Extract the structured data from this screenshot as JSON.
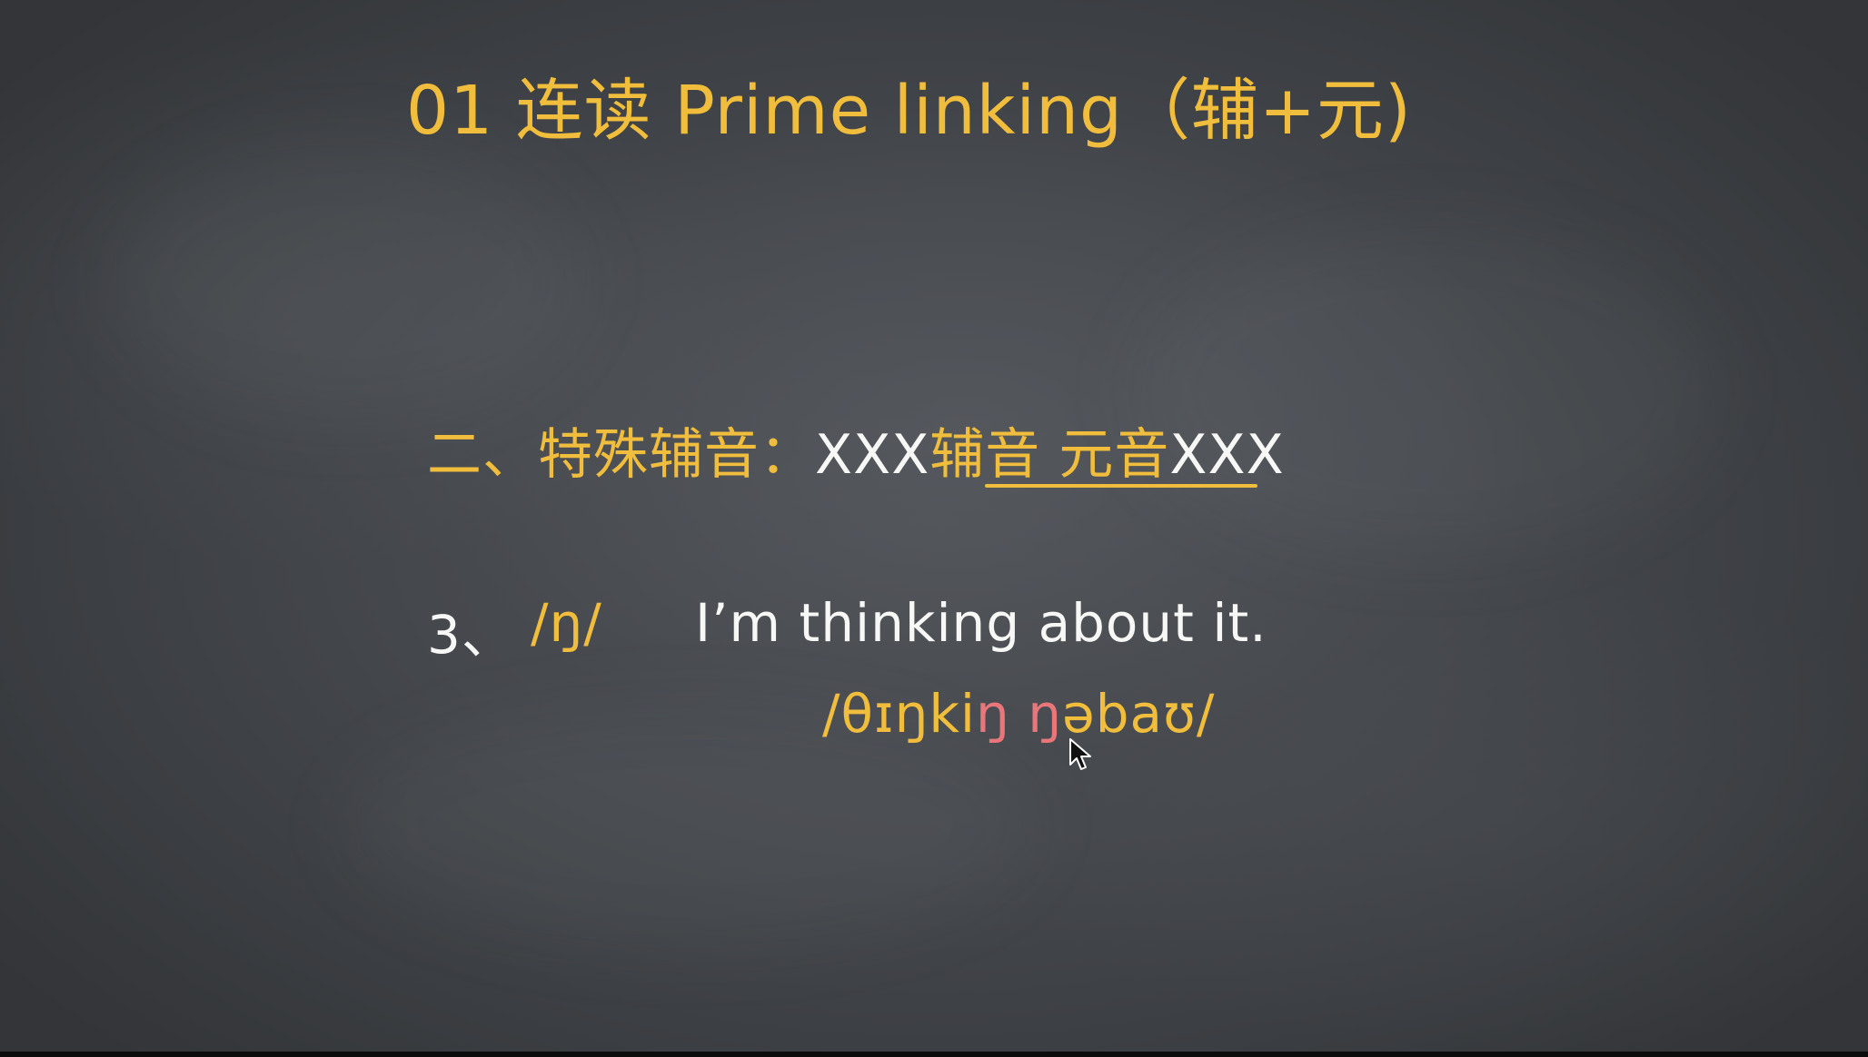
{
  "slide": {
    "title": "01 连读 Prime linking（辅+元)",
    "rule": {
      "prefix": "二、特殊辅音：",
      "left_xxx": "XXX",
      "underlined": "辅音 元音",
      "right_xxx": "XXX"
    },
    "example": {
      "number": "3、",
      "phoneme": "/ŋ/",
      "sentence": "I’m thinking about it.",
      "ipa_start": "/θɪŋki",
      "ipa_linked_1": "ŋ",
      "ipa_space": " ",
      "ipa_linked_2": "ŋ",
      "ipa_end": "əbaʊ/"
    }
  },
  "colors": {
    "chalkboard": "#45484d",
    "yellow_chalk": "#f0bd3c",
    "white_chalk": "#f7f7f5",
    "pink_chalk": "#e8767a"
  },
  "icons": {
    "cursor": "mouse-pointer-icon"
  }
}
